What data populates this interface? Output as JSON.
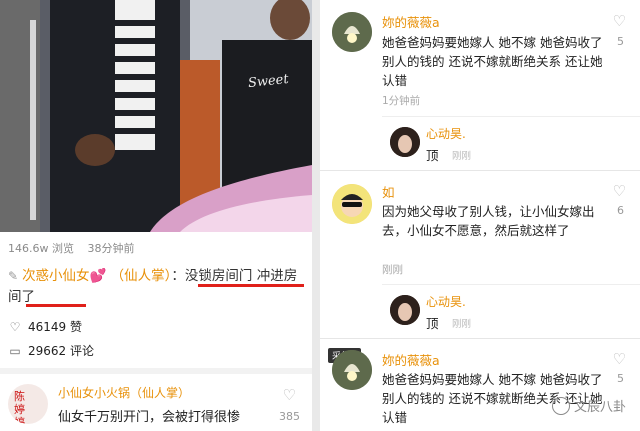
{
  "left": {
    "stats": {
      "views": "146.6w 浏览",
      "time": "38分钟前"
    },
    "caption": {
      "author": "次惑小仙女",
      "author_tag": "💕 （仙人掌）",
      "colon": "：",
      "text": "没锁房间门 冲进房间了"
    },
    "likes": "46149 赞",
    "comments": "29662 评论",
    "comment": {
      "avatar_text": "陈\n婷\n婷",
      "name": "小仙女小火锅（仙人掌）",
      "body": "仙女千万别开门，会被打得很惨",
      "like_count": "385"
    },
    "sweater_text": "Sweet"
  },
  "right": {
    "comments": [
      {
        "name": "妳的薇薇a",
        "text": "她爸爸妈妈要她嫁人  她不嫁  她爸妈收了别人的钱的 还说不嫁就断绝关系 还让她认错",
        "time": "1分钟前",
        "like_count": "5"
      },
      {
        "name": "如",
        "text": "因为她父母收了别人钱，让小仙女嫁出去，小仙女不愿意，然后就这样了",
        "time": "刚刚",
        "like_count": "6",
        "tag": "采集 ▾"
      },
      {
        "name": "妳的薇薇a",
        "text": "她爸爸妈妈要她嫁人  她不嫁  她爸妈收了别人的钱的 还说不嫁就断绝关系 还让她认错",
        "like_count": "5"
      }
    ],
    "replies": [
      {
        "name": "心动昊.",
        "text": "顶",
        "time": "刚刚"
      },
      {
        "name": "心动昊.",
        "text": "顶",
        "time": "刚刚"
      }
    ],
    "watermark": "文辰八卦"
  }
}
